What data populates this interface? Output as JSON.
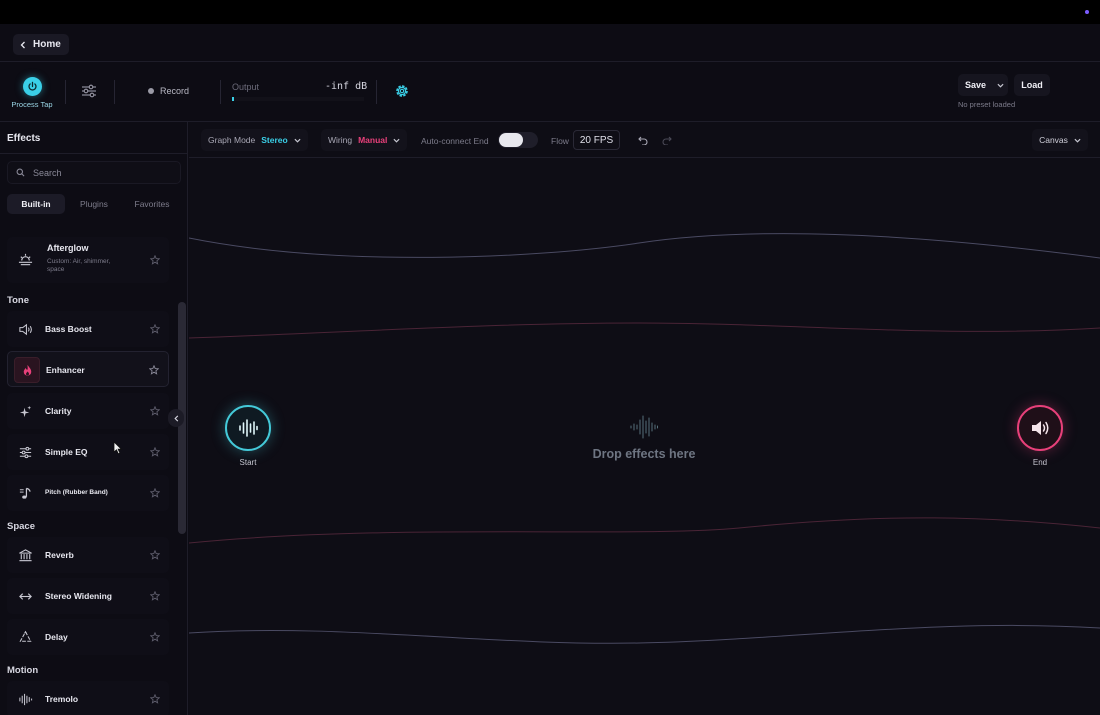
{
  "nav": {
    "home_label": "Home"
  },
  "toolbar": {
    "process_tap_label": "Process Tap",
    "record_label": "Record",
    "output_label": "Output",
    "output_value": "-inf dB",
    "output_level": 0.0,
    "save_label": "Save",
    "load_label": "Load",
    "preset_status": "No preset loaded"
  },
  "sidebar": {
    "title": "Effects",
    "search_placeholder": "Search",
    "tabs": [
      "Built-in",
      "Plugins",
      "Favorites"
    ],
    "active_tab": "Built-in",
    "partial_item": {
      "name": "Afterglow",
      "desc": "Custom: Air, shimmer, space",
      "icon": "sunset-icon"
    },
    "categories": [
      {
        "name": "Tone",
        "items": [
          {
            "name": "Bass Boost",
            "icon": "speaker-icon"
          },
          {
            "name": "Enhancer",
            "icon": "flame-icon",
            "selected": true
          },
          {
            "name": "Clarity",
            "icon": "sparkle-icon"
          },
          {
            "name": "Simple EQ",
            "icon": "sliders-icon"
          },
          {
            "name": "Pitch (Rubber Band)",
            "icon": "music-note-icon"
          }
        ]
      },
      {
        "name": "Space",
        "items": [
          {
            "name": "Reverb",
            "icon": "columns-icon"
          },
          {
            "name": "Stereo Widening",
            "icon": "arrows-horizontal-icon"
          },
          {
            "name": "Delay",
            "icon": "recycle-icon"
          }
        ]
      },
      {
        "name": "Motion",
        "items": [
          {
            "name": "Tremolo",
            "icon": "waveform-icon"
          }
        ]
      }
    ]
  },
  "canvas_toolbar": {
    "graph_mode_label": "Graph Mode",
    "graph_mode_value": "Stereo",
    "wiring_label": "Wiring",
    "wiring_value": "Manual",
    "auto_connect_label": "Auto-connect End",
    "auto_connect_on": false,
    "flow_label": "Flow",
    "flow_value": "20 FPS",
    "view_value": "Canvas"
  },
  "canvas": {
    "start_label": "Start",
    "end_label": "End",
    "drop_text": "Drop effects here"
  },
  "colors": {
    "accent_cyan": "#3ad0e8",
    "accent_pink": "#e8407a",
    "background": "#0d0c14"
  }
}
